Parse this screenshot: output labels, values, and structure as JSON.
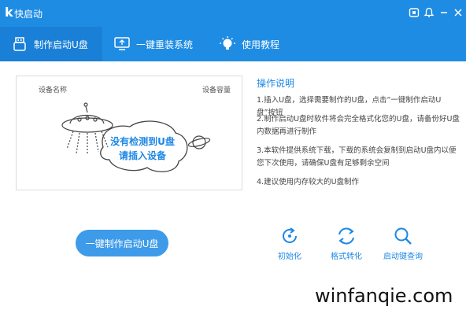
{
  "app": {
    "logo": "k",
    "title": "快启动"
  },
  "tabs": [
    {
      "label": "制作启动U盘",
      "icon": "usb-drive-icon",
      "active": true
    },
    {
      "label": "一键重装系统",
      "icon": "monitor-icon",
      "active": false
    },
    {
      "label": "使用教程",
      "icon": "lightbulb-icon",
      "active": false
    }
  ],
  "device_panel": {
    "col_name": "设备名称",
    "col_capacity": "设备容量",
    "empty_line1": "没有检测到U盘",
    "empty_line2": "请插入设备"
  },
  "instructions": {
    "title": "操作说明",
    "steps": [
      "1.插入U盘，选择需要制作的U盘，点击“一键制作启动U盘”按钮",
      "2.制作启动U盘时软件将会完全格式化您的U盘，请备份好U盘内数据再进行制作",
      "3.本软件提供系统下载，下载的系统会复制到启动U盘内以便您下次使用，请确保U盘有足够剩余空间",
      "4.建议使用内存较大的U盘制作"
    ]
  },
  "actions": {
    "make_button": "一键制作启动U盘",
    "tools": [
      {
        "label": "初始化",
        "icon": "refresh-icon"
      },
      {
        "label": "格式转化",
        "icon": "convert-icon"
      },
      {
        "label": "启动键查询",
        "icon": "search-icon"
      }
    ]
  },
  "watermark": "winfanqie.com",
  "colors": {
    "primary": "#1f8ce3",
    "accent_text": "#1e88e5",
    "button": "#3d9be9"
  }
}
